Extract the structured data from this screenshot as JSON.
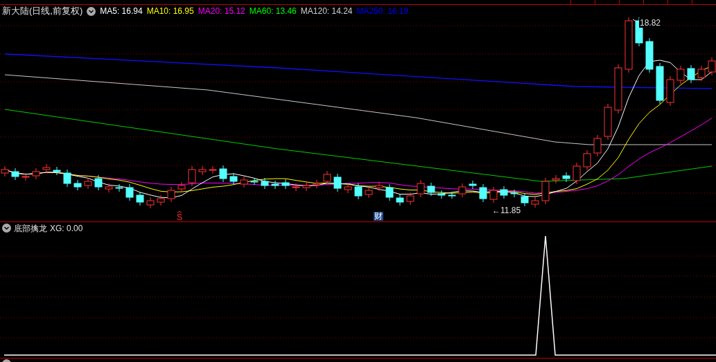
{
  "toolbar": {
    "tabs": [
      {
        "selected": false
      },
      {
        "selected": false
      },
      {
        "selected": false
      },
      {
        "selected": false
      },
      {
        "selected": false
      },
      {
        "selected": false
      }
    ]
  },
  "header": {
    "title": "新大陆(日线,前复权)",
    "moving_averages": [
      {
        "label": "MA5: 16.94",
        "color": "#ffffff"
      },
      {
        "label": "MA10: 16.95",
        "color": "#ffff00"
      },
      {
        "label": "MA20: 15.12",
        "color": "#ff00ff"
      },
      {
        "label": "MA60: 13.46",
        "color": "#00ff00"
      },
      {
        "label": "MA120: 14.24",
        "color": "#d0d0d0"
      },
      {
        "label": "MA250: 16.19",
        "color": "#0000ff"
      }
    ]
  },
  "price_chart": {
    "high_label": "18.82",
    "low_label": "←11.85",
    "signals": [
      {
        "kind": "buy",
        "text": "S"
      },
      {
        "kind": "news",
        "text": "财"
      }
    ]
  },
  "indicator": {
    "title": "底部擒龙",
    "reading": "XG: 0.00"
  }
}
